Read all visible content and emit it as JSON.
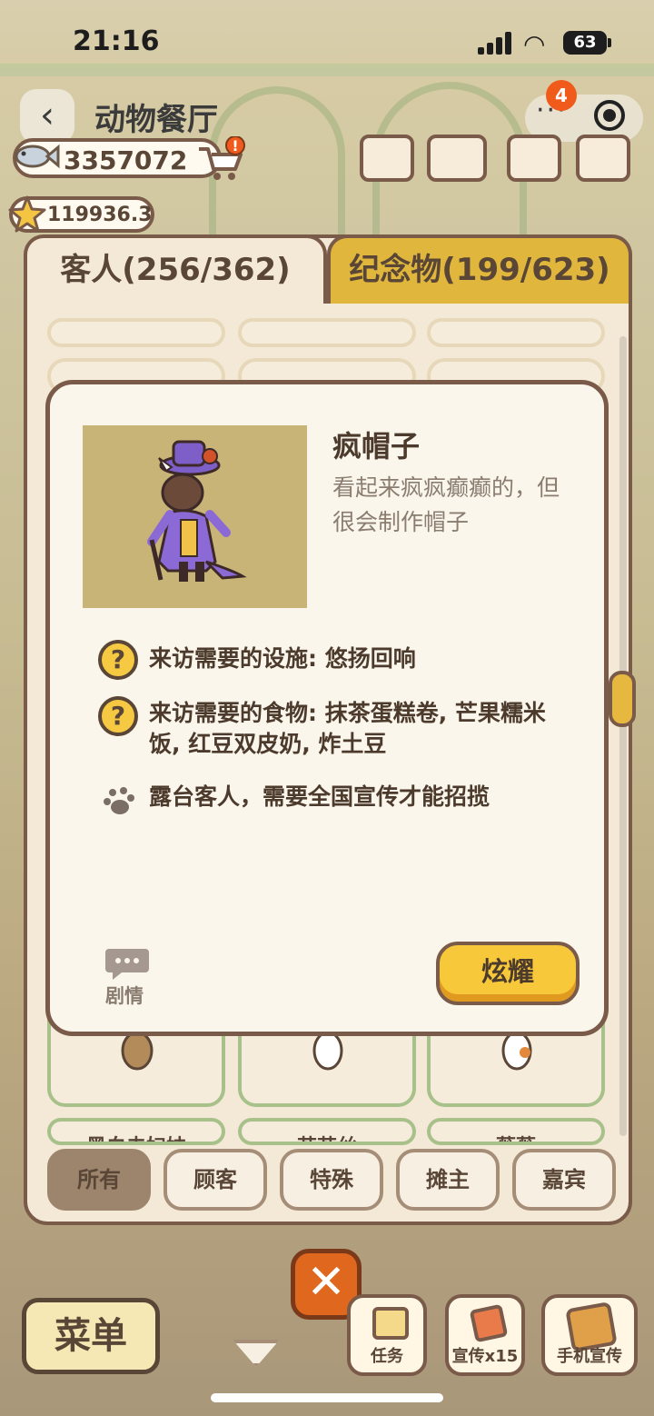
{
  "status_bar": {
    "time": "21:16",
    "battery": "63"
  },
  "header": {
    "title": "动物餐厅",
    "notification_count": "4"
  },
  "currency": {
    "fish": "3357072",
    "stars": "119936.3"
  },
  "tabs": [
    {
      "label": "客人(256/362)",
      "active": true
    },
    {
      "label": "纪念物(199/623)",
      "active": false
    }
  ],
  "grid": {
    "row1_names": [
      "",
      "",
      ""
    ],
    "row5_names": [
      "黑白夫妇妹",
      "苏苏丝",
      "薇薇"
    ]
  },
  "dialog": {
    "name": "疯帽子",
    "description": "看起来疯疯癫癫的，但很会制作帽子",
    "requirement_facility": "来访需要的设施: 悠扬回响",
    "requirement_food": "来访需要的食物: 抹茶蛋糕卷, 芒果糯米饭, 红豆双皮奶, 炸土豆",
    "note": "露台客人，需要全国宣传才能招揽",
    "story_label": "剧情",
    "show_button": "炫耀",
    "question_mark": "?"
  },
  "filters": [
    {
      "label": "所有",
      "active": true
    },
    {
      "label": "顾客",
      "active": false
    },
    {
      "label": "特殊",
      "active": false
    },
    {
      "label": "摊主",
      "active": false
    },
    {
      "label": "嘉宾",
      "active": false
    }
  ],
  "bottom_bar": {
    "menu": "菜单",
    "close": "✕",
    "task": "任务",
    "promo": "宣传x15",
    "phone_promo": "手机宣传"
  }
}
